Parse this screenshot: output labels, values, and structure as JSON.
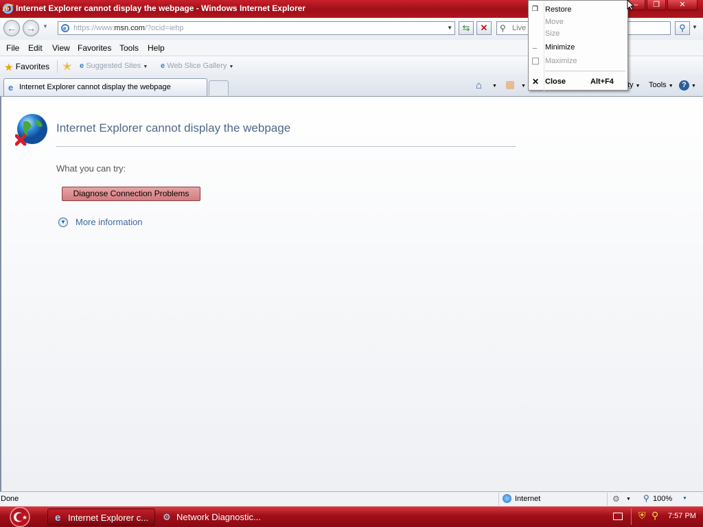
{
  "window": {
    "title": "Internet Explorer cannot display the webpage - Windows Internet Explorer",
    "controls": {
      "minimize": "‒",
      "maximize": "❐",
      "close": "✕"
    }
  },
  "address_bar": {
    "url_prefix": "https://www.",
    "url_domain": "msn.com",
    "url_suffix": "/?ocid=iehp",
    "search_placeholder": "Live"
  },
  "menu": [
    "File",
    "Edit",
    "View",
    "Favorites",
    "Tools",
    "Help"
  ],
  "favorites_bar": {
    "favorites_label": "Favorites",
    "suggested_sites": "Suggested Sites",
    "web_slice_gallery": "Web Slice Gallery"
  },
  "tabs": {
    "active_label": "Internet Explorer cannot display the webpage",
    "toolbar_right_partial": "ty",
    "tools_label": "Tools"
  },
  "page": {
    "error_title": "Internet Explorer cannot display the webpage",
    "try_label": "What you can try:",
    "diagnose_button": "Diagnose Connection Problems",
    "more_info": "More information"
  },
  "status_bar": {
    "status": "Done",
    "zone": "Internet",
    "zoom": "100%"
  },
  "taskbar": {
    "items": [
      "Internet Explorer c...",
      "Network Diagnostic..."
    ],
    "clock": "7:57 PM"
  },
  "system_menu": {
    "items": [
      {
        "label": "Restore",
        "enabled": true
      },
      {
        "label": "Move",
        "enabled": false
      },
      {
        "label": "Size",
        "enabled": false
      },
      {
        "label": "Minimize",
        "enabled": true
      },
      {
        "label": "Maximize",
        "enabled": false
      },
      {
        "label": "Close",
        "enabled": true,
        "shortcut": "Alt+F4"
      }
    ]
  },
  "colors": {
    "titlebar": "#b5141e",
    "taskbar": "#a00f18",
    "error_title": "#4e6887",
    "link": "#3c6aa3"
  }
}
